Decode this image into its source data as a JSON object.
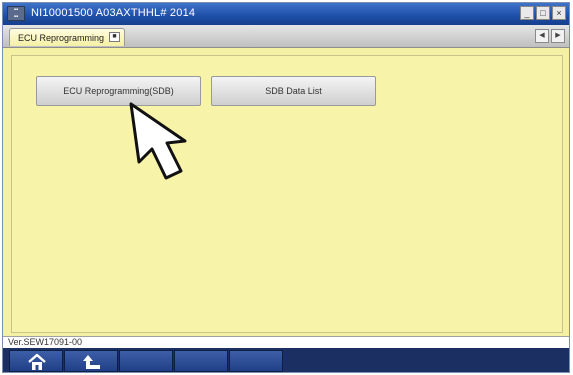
{
  "window": {
    "title": "NI10001500  A03AXTHHL# 2014",
    "app_icon": "app-icon",
    "controls": [
      {
        "name": "minimize-icon",
        "glyph": "_"
      },
      {
        "name": "maximize-icon",
        "glyph": "□"
      },
      {
        "name": "close-icon",
        "glyph": "×"
      }
    ]
  },
  "tabs": [
    {
      "label": "ECU Reprogramming",
      "close_glyph": "■",
      "active": true
    }
  ],
  "tab_nav": {
    "prev_glyph": "◀",
    "next_glyph": "▶"
  },
  "main": {
    "buttons": [
      {
        "label": "ECU Reprogramming(SDB)"
      },
      {
        "label": "SDB Data List"
      }
    ],
    "pointer": "pointer-cursor-icon"
  },
  "status": {
    "version": "Ver.SEW17091-00"
  },
  "bottom_nav": {
    "buttons": [
      {
        "icon": "home-icon"
      },
      {
        "icon": "return-arrow-icon"
      },
      {
        "icon": ""
      },
      {
        "icon": ""
      },
      {
        "icon": ""
      }
    ]
  },
  "colors": {
    "titlebar": "#1d4fa8",
    "content_bg": "#f4f0a4",
    "bottom_bar": "#1c2f63"
  }
}
